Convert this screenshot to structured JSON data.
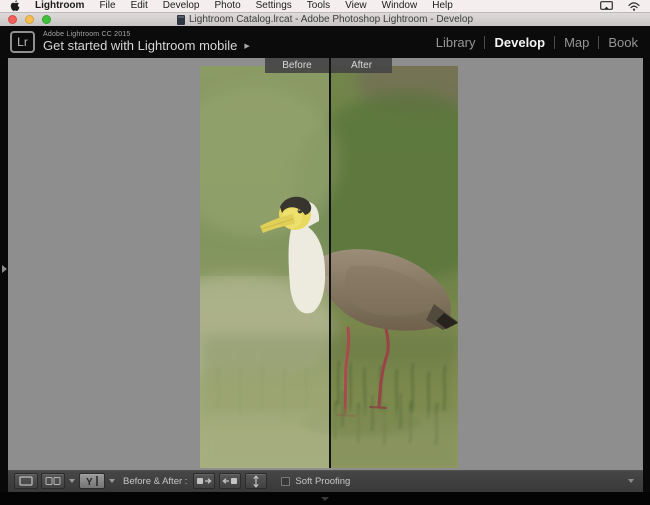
{
  "menu_bar": {
    "items": [
      "Lightroom",
      "File",
      "Edit",
      "Develop",
      "Photo",
      "Settings",
      "Tools",
      "View",
      "Window",
      "Help"
    ],
    "status_icons": [
      "display-mirroring",
      "wifi"
    ]
  },
  "window": {
    "title": "Lightroom Catalog.lrcat - Adobe Photoshop Lightroom - Develop"
  },
  "header": {
    "logo": "Lr",
    "app_version_line": "Adobe Lightroom CC 2015",
    "tagline": "Get started with Lightroom mobile",
    "tagline_arrow": "▶",
    "modules": [
      {
        "label": "Library",
        "active": false
      },
      {
        "label": "Develop",
        "active": true
      },
      {
        "label": "Map",
        "active": false
      },
      {
        "label": "Book",
        "active": false
      }
    ]
  },
  "viewer": {
    "before_label": "Before",
    "after_label": "After",
    "content_description": "Split before/after view of a masked lapwing bird standing in green grass"
  },
  "toolbar": {
    "before_after_label": "Before & After :",
    "y_icon_text": "Y",
    "soft_proofing": {
      "label": "Soft Proofing",
      "checked": false
    }
  },
  "colors": {
    "workspace_bg": "#8e8e8e",
    "header_bg": "#0b0b0b",
    "toolbar_bg": "#3e3e3e",
    "module_active": "#f4f4f4",
    "module_inactive": "#969696",
    "traffic_red": "#f4605a",
    "traffic_yellow": "#f6be4f",
    "traffic_green": "#3fc13c",
    "label_chip_bg": "#464646"
  }
}
